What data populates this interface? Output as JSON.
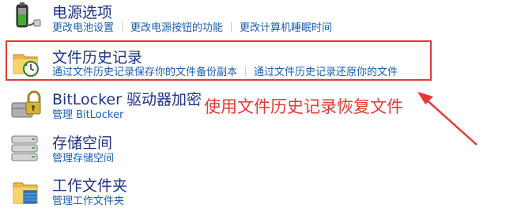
{
  "items": [
    {
      "title": "电源选项",
      "links": [
        "更改电池设置",
        "更改电源按钮的功能",
        "更改计算机睡眠时间"
      ]
    },
    {
      "title": "文件历史记录",
      "links": [
        "通过文件历史记录保存你的文件备份副本",
        "通过文件历史记录还原你的文件"
      ]
    },
    {
      "title": "BitLocker 驱动器加密",
      "links": [
        "管理 BitLocker"
      ]
    },
    {
      "title": "存储空间",
      "links": [
        "管理存储空间"
      ]
    },
    {
      "title": "工作文件夹",
      "links": [
        "管理工作文件夹"
      ]
    }
  ],
  "annotation": "使用文件历史记录恢复文件",
  "colors": {
    "title": "#1e3287",
    "link": "#1a5fb4",
    "annotation": "#e53935"
  }
}
